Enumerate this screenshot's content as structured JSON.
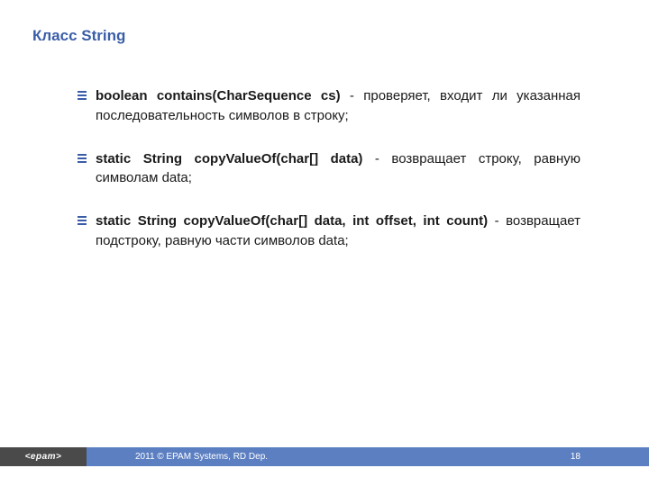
{
  "title": "Класс String",
  "bullets": [
    {
      "signature": "boolean contains(CharSequence cs)",
      "desc": " - проверяет, входит ли указанная последовательность символов в строку;"
    },
    {
      "signature": "static String copyValueOf(char[] data)",
      "desc": " - возвращает строку, равную символам data;"
    },
    {
      "signature": "static String copyValueOf(char[] data, int offset, int count)",
      "desc": " - возвращает подстроку, равную части символов data;"
    }
  ],
  "footer": {
    "logo": "<epam>",
    "copyright": "2011 © EPAM Systems, RD Dep.",
    "page": "18"
  }
}
